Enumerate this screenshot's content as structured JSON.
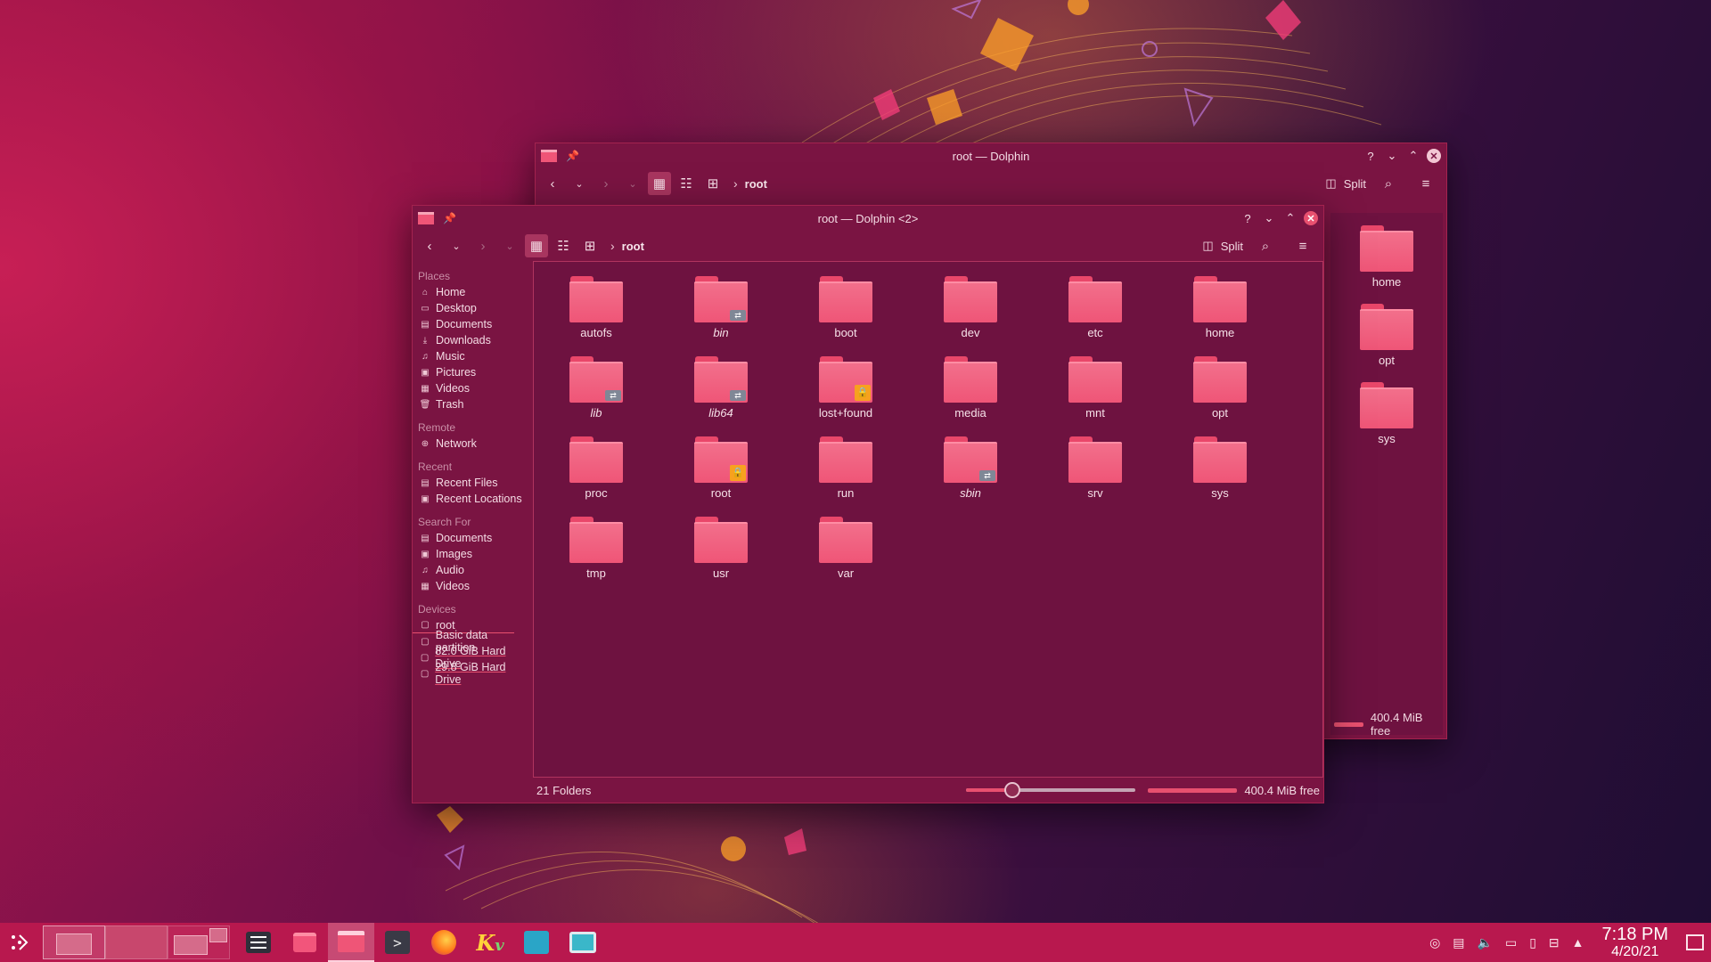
{
  "back_window": {
    "title": "root — Dolphin",
    "crumb": "root",
    "split_label": "Split",
    "visible_folders": [
      "home",
      "opt",
      "sys"
    ],
    "free_label": "400.4 MiB free"
  },
  "front_window": {
    "title": "root — Dolphin <2>",
    "crumb": "root",
    "split_label": "Split",
    "sidebar": {
      "places_head": "Places",
      "places": [
        {
          "label": "Home",
          "icon": "home-icon"
        },
        {
          "label": "Desktop",
          "icon": "desktop-icon"
        },
        {
          "label": "Documents",
          "icon": "documents-icon"
        },
        {
          "label": "Downloads",
          "icon": "downloads-icon"
        },
        {
          "label": "Music",
          "icon": "music-icon"
        },
        {
          "label": "Pictures",
          "icon": "pictures-icon"
        },
        {
          "label": "Videos",
          "icon": "videos-icon"
        },
        {
          "label": "Trash",
          "icon": "trash-icon"
        }
      ],
      "remote_head": "Remote",
      "remote": [
        {
          "label": "Network",
          "icon": "network-icon"
        }
      ],
      "recent_head": "Recent",
      "recent": [
        {
          "label": "Recent Files",
          "icon": "recent-files-icon"
        },
        {
          "label": "Recent Locations",
          "icon": "recent-locations-icon"
        }
      ],
      "search_head": "Search For",
      "search": [
        {
          "label": "Documents",
          "icon": "documents-icon"
        },
        {
          "label": "Images",
          "icon": "images-icon"
        },
        {
          "label": "Audio",
          "icon": "audio-icon"
        },
        {
          "label": "Videos",
          "icon": "videos-icon"
        }
      ],
      "devices_head": "Devices",
      "devices": [
        {
          "label": "root",
          "icon": "drive-icon"
        },
        {
          "label": "Basic data partition",
          "icon": "drive-icon"
        },
        {
          "label": "82.0 GiB Hard Drive",
          "icon": "drive-icon"
        },
        {
          "label": "29.8 GiB Hard Drive",
          "icon": "drive-icon"
        }
      ]
    },
    "folders": [
      {
        "name": "autofs",
        "italic": false,
        "emblem": ""
      },
      {
        "name": "bin",
        "italic": true,
        "emblem": "link"
      },
      {
        "name": "boot",
        "italic": false,
        "emblem": ""
      },
      {
        "name": "dev",
        "italic": false,
        "emblem": ""
      },
      {
        "name": "etc",
        "italic": false,
        "emblem": ""
      },
      {
        "name": "home",
        "italic": false,
        "emblem": ""
      },
      {
        "name": "lib",
        "italic": true,
        "emblem": "link"
      },
      {
        "name": "lib64",
        "italic": true,
        "emblem": "link"
      },
      {
        "name": "lost+found",
        "italic": false,
        "emblem": "lock"
      },
      {
        "name": "media",
        "italic": false,
        "emblem": ""
      },
      {
        "name": "mnt",
        "italic": false,
        "emblem": ""
      },
      {
        "name": "opt",
        "italic": false,
        "emblem": ""
      },
      {
        "name": "proc",
        "italic": false,
        "emblem": ""
      },
      {
        "name": "root",
        "italic": false,
        "emblem": "lock"
      },
      {
        "name": "run",
        "italic": false,
        "emblem": ""
      },
      {
        "name": "sbin",
        "italic": true,
        "emblem": "link"
      },
      {
        "name": "srv",
        "italic": false,
        "emblem": ""
      },
      {
        "name": "sys",
        "italic": false,
        "emblem": ""
      },
      {
        "name": "tmp",
        "italic": false,
        "emblem": ""
      },
      {
        "name": "usr",
        "italic": false,
        "emblem": ""
      },
      {
        "name": "var",
        "italic": false,
        "emblem": ""
      }
    ],
    "status": {
      "count_label": "21 Folders",
      "zoom_fraction": 0.27,
      "free_label": "400.4 MiB free"
    }
  },
  "taskbar": {
    "apps": [
      "app-launcher-icon",
      "pager",
      "system-settings-icon",
      "discover-icon",
      "dolphin-icon",
      "konsole-icon",
      "firefox-icon",
      "kvantum-icon",
      "kate-icon",
      "screenshot-icon"
    ],
    "clock_time": "7:18 PM",
    "clock_date": "4/20/21"
  },
  "colors": {
    "accent": "#e8506f",
    "window_bg": "#7a1442",
    "taskbar_bg": "#b8184e",
    "folder": "#ef5577"
  }
}
